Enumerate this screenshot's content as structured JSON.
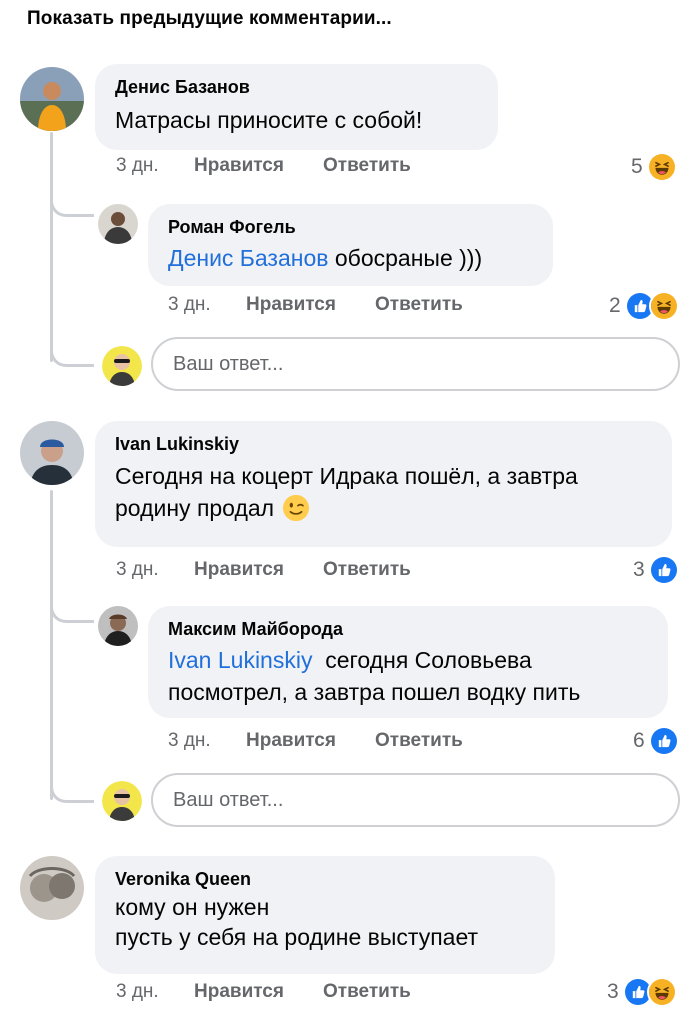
{
  "show_previous": "Показать предыдущие комментарии...",
  "reply_placeholder": "Ваш ответ...",
  "actions": {
    "like": "Нравится",
    "reply": "Ответить"
  },
  "comments": [
    {
      "author": "Денис Базанов",
      "text": "Матрасы приносите с собой!",
      "time": "3 дн.",
      "reaction_count": "5",
      "reactions": [
        "haha-icon"
      ],
      "replies": [
        {
          "author": "Роман Фогель",
          "mention": "Денис Базанов",
          "text": " обосраные )))",
          "time": "3 дн.",
          "reaction_count": "2",
          "reactions": [
            "like-icon",
            "haha-icon"
          ]
        }
      ]
    },
    {
      "author": "Ivan Lukinskiy",
      "text_line1": "Сегодня на коцерт Идрака пошёл, а завтра",
      "text_line2": "родину продал",
      "emoji": "wink-emoji",
      "time": "3 дн.",
      "reaction_count": "3",
      "reactions": [
        "like-icon"
      ],
      "replies": [
        {
          "author": "Максим Майборода",
          "mention": "Ivan Lukinskiy",
          "text_line1": "  сегодня Соловьева",
          "text_line2": "посмотрел, а завтра пошел водку пить",
          "time": "3 дн.",
          "reaction_count": "6",
          "reactions": [
            "like-icon"
          ]
        }
      ]
    },
    {
      "author": "Veronika Queen",
      "text_line1": "кому он нужен",
      "text_line2": "пусть у себя на родине выступает",
      "time": "3 дн.",
      "reaction_count": "3",
      "reactions": [
        "like-icon",
        "haha-icon"
      ]
    }
  ],
  "colors": {
    "like_blue": "#1877f2",
    "haha_yellow": "#f7b125",
    "mention_blue": "#216fdb",
    "bubble_bg": "#f0f2f5",
    "meta_gray": "#65676b"
  }
}
